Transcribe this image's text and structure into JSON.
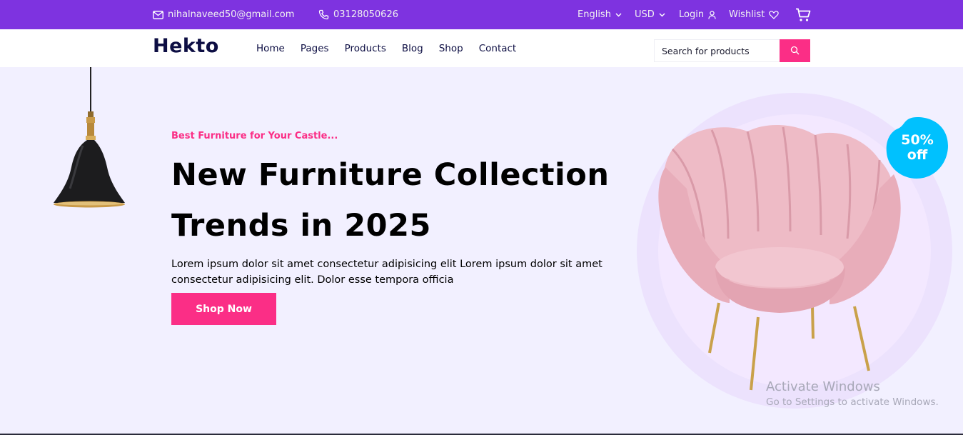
{
  "topbar": {
    "email": "nihalnaveed50@gmail.com",
    "phone": "03128050626",
    "language": "English",
    "currency": "USD",
    "login": "Login",
    "wishlist": "Wishlist"
  },
  "nav": {
    "logo": "Hekto",
    "links": [
      "Home",
      "Pages",
      "Products",
      "Blog",
      "Shop",
      "Contact"
    ],
    "search_placeholder": "Search for products"
  },
  "hero": {
    "kicker": "Best Furniture for Your Castle...",
    "headline": "New Furniture Collection Trends in 2025",
    "paragraph": "Lorem ipsum dolor sit amet consectetur adipisicing elit Lorem ipsum dolor sit amet consectetur adipisicing elit. Dolor esse tempora officia",
    "button": "Shop Now",
    "badge_line1": "50%",
    "badge_line2": "off"
  },
  "watermark": {
    "title": "Activate Windows",
    "subtitle": "Go to Settings to activate Windows."
  },
  "colors": {
    "topbar": "#7e33e0",
    "accent": "#fb2e86",
    "hero_bg": "#f2f0ff",
    "badge": "#00c1fe"
  },
  "icons": [
    "mail-icon",
    "phone-icon",
    "chevron-down-icon",
    "user-icon",
    "heart-icon",
    "cart-icon",
    "search-icon"
  ]
}
